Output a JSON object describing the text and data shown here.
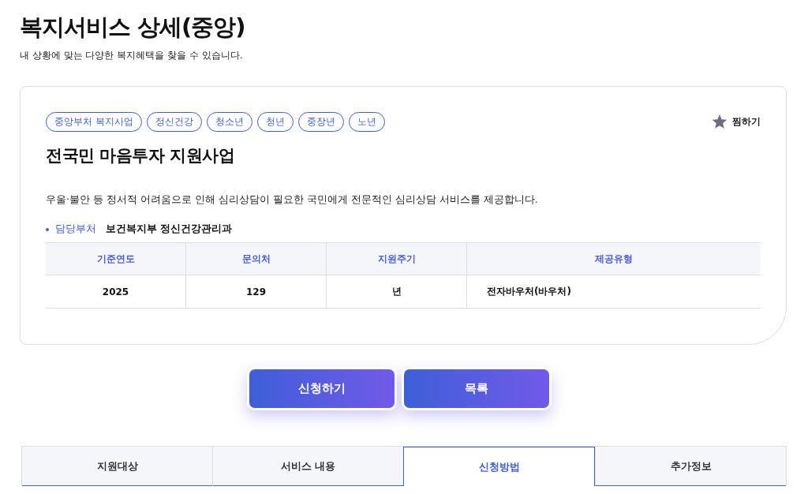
{
  "page": {
    "title": "복지서비스 상세(중앙)",
    "subtitle": "내 상황에 맞는 다양한 복지혜택을 찾을 수 있습니다."
  },
  "service": {
    "tags": [
      "중앙부처 복지사업",
      "정신건강",
      "청소년",
      "청년",
      "중장년",
      "노년"
    ],
    "favorite": {
      "label": "찜하기",
      "selected": false
    },
    "name": "전국민 마음투자 지원사업",
    "description": "우울·불안 등 정서적 어려움으로 인해 심리상담이 필요한 국민에게 전문적인 심리상담 서비스를 제공합니다.",
    "department": {
      "label": "담당부처",
      "value": "보건복지부 정신건강관리과"
    },
    "table": {
      "columns": [
        "기준연도",
        "문의처",
        "지원주기",
        "제공유형"
      ],
      "rows": [
        [
          "2025",
          "129",
          "년",
          "전자바우처(바우처)"
        ]
      ]
    }
  },
  "buttons": [
    "신청하기",
    "목록"
  ],
  "tabs": [
    {
      "label": "지원대상",
      "selected": false
    },
    {
      "label": "서비스 내용",
      "selected": false
    },
    {
      "label": "신청방법",
      "selected": true
    },
    {
      "label": "추가정보",
      "selected": false
    }
  ]
}
